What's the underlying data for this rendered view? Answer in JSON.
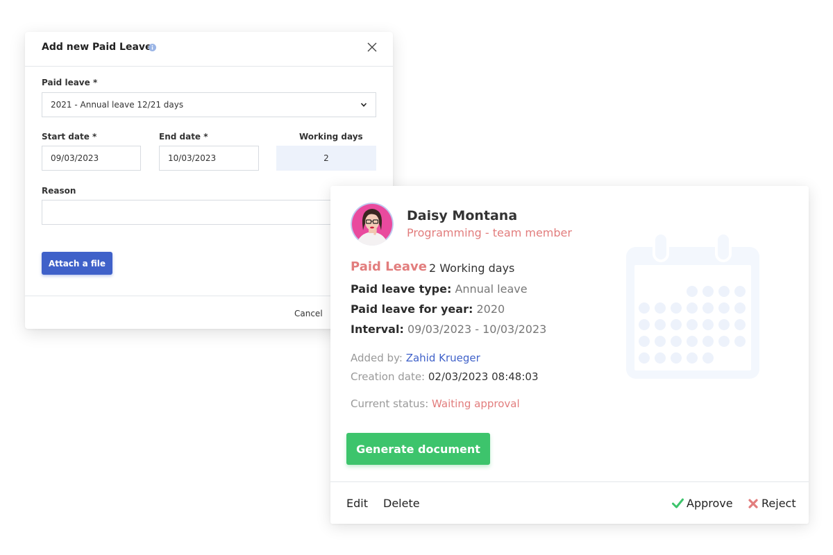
{
  "modal": {
    "title": "Add new Paid Leave",
    "icons": {
      "info": "info-icon",
      "close": "close-icon"
    },
    "paid_leave_label": "Paid leave *",
    "paid_leave_value": "2021 - Annual leave 12/21 days",
    "start_date_label": "Start date *",
    "start_date_value": "09/03/2023",
    "end_date_label": "End date *",
    "end_date_value": "10/03/2023",
    "working_days_label": "Working days",
    "working_days_value": "2",
    "reason_label": "Reason",
    "reason_value": "",
    "attach_label": "Attach a file",
    "cancel_label": "Cancel"
  },
  "card": {
    "name": "Daisy Montana",
    "role": "Programming - team member",
    "leave_title": "Paid Leave",
    "leave_days": "2 Working days",
    "type_label": "Paid leave type:",
    "type_value": "Annual leave",
    "year_label": "Paid leave for year:",
    "year_value": "2020",
    "interval_label": "Interval:",
    "interval_value": "09/03/2023 - 10/03/2023",
    "added_by_label": "Added by:",
    "added_by_value": "Zahid Krueger",
    "creation_label": "Creation date:",
    "creation_value": "02/03/2023 08:48:03",
    "status_label": "Current status:",
    "status_value": "Waiting approval",
    "generate_label": "Generate document",
    "edit_label": "Edit",
    "delete_label": "Delete",
    "approve_label": "Approve",
    "reject_label": "Reject",
    "icons": {
      "approve": "check-icon",
      "reject": "x-icon",
      "illustration": "calendar-icon"
    }
  },
  "colors": {
    "primary": "#3f61c9",
    "accent": "#e27d7d",
    "success": "#3dc46c",
    "highlight": "#edf2fb"
  }
}
